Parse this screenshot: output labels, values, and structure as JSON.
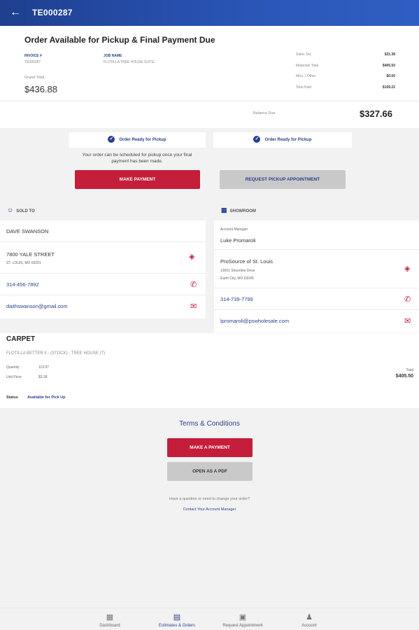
{
  "header": {
    "title": "TE000287"
  },
  "order": {
    "heading": "Order Available for Pickup & Final Payment Due",
    "invoice_label": "INVOICE #",
    "invoice_value": "TE000287",
    "job_label": "JOB NAME",
    "job_value": "FLOTILLA TREE HOUSE SUITE",
    "grand_total_label": "Grand Total",
    "grand_total_value": "$436.88",
    "totals": [
      {
        "label": "Sales Tax",
        "value": "$31.38"
      },
      {
        "label": "Materials Total",
        "value": "$405.50"
      },
      {
        "label": "Misc. / Other",
        "value": "$0.00"
      },
      {
        "label": "Total Paid",
        "value": "$109.22"
      }
    ],
    "balance_label": "Balance Due",
    "balance_value": "$327.66"
  },
  "status_panels": {
    "left_pill": "Order Ready for Pickup",
    "right_pill": "Order Ready for Pickup",
    "message": "Your order can be scheduled for pickup once your final payment has been made.",
    "make_payment": "MAKE PAYMENT",
    "request_pickup": "REQUEST PICKUP APPOINTMENT"
  },
  "sold_to": {
    "title": "SOLD TO",
    "name": "DAVE SWANSON",
    "street": "7800 YALE STREET",
    "city": "ST. LOUIS, MO 65201",
    "phone": "314-456-7892",
    "email": "daithswanson@gmail.com"
  },
  "showroom": {
    "title": "SHOWROOM",
    "manager_label": "Account Manager",
    "manager_name": "Luke Promaroli",
    "store_name": "ProSource of St. Louis",
    "store_street": "13001 Shoreline Drive",
    "store_city": "Earth City, MO 63045",
    "phone": "314-739-7799",
    "email": "lpromaroli@pswholesale.com"
  },
  "product": {
    "category": "CARPET",
    "description": "FLOTILLA BETTER II - (STOCK) - TREE HOUSE (T)",
    "quantity_label": "Quantity",
    "quantity_value": "119.97",
    "unit_price_label": "Unit Price",
    "unit_price_value": "$3.38",
    "total_label": "Total",
    "total_value": "$405.50",
    "status_label": "Status",
    "status_value": "Available for Pick Up"
  },
  "footer": {
    "terms": "Terms & Conditions",
    "make_a_payment": "MAKE A PAYMENT",
    "open_pdf": "OPEN AS A PDF",
    "question": "Have a question or need to change your order?",
    "contact": "Contact Your Account Manager"
  },
  "nav": [
    {
      "label": "Dashboard",
      "icon": "dashboard-icon"
    },
    {
      "label": "Estimates & Orders",
      "icon": "document-icon"
    },
    {
      "label": "Request Appointment",
      "icon": "calendar-icon"
    },
    {
      "label": "Account",
      "icon": "person-icon"
    }
  ]
}
